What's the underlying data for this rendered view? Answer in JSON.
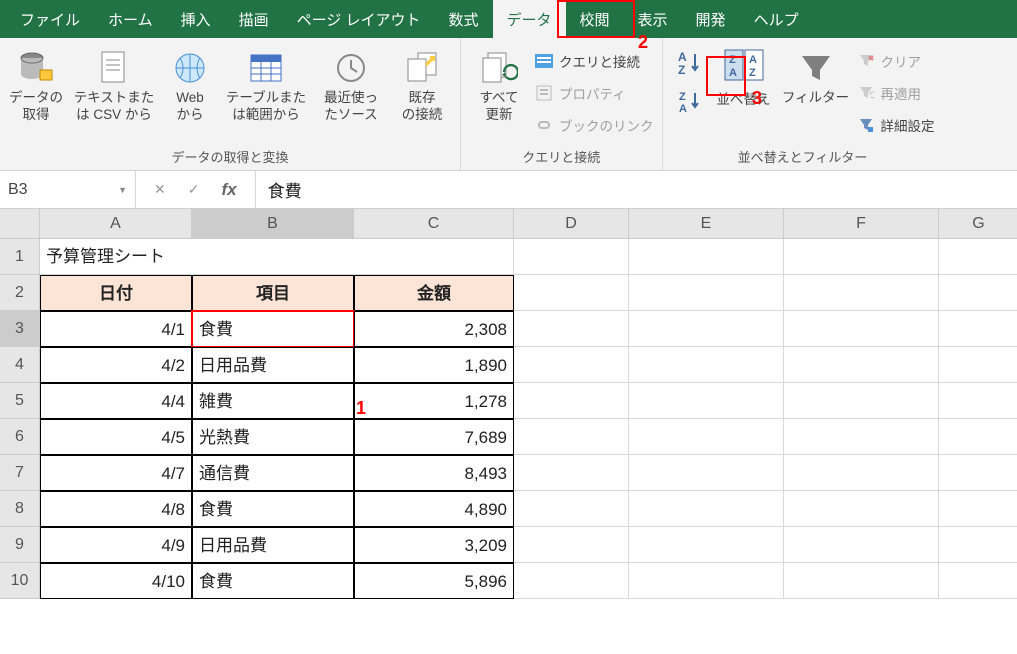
{
  "tabs": [
    "ファイル",
    "ホーム",
    "挿入",
    "描画",
    "ページ レイアウト",
    "数式",
    "データ",
    "校閲",
    "表示",
    "開発",
    "ヘルプ"
  ],
  "active_tab": "データ",
  "ribbon": {
    "group1": {
      "label": "データの取得と変換",
      "btns": {
        "get_data": "データの\n取得",
        "csv": "テキストまた\nは CSV から",
        "web": "Web\nから",
        "table": "テーブルまた\nは範囲から",
        "recent": "最近使っ\nたソース",
        "existing": "既存\nの接続"
      }
    },
    "group2": {
      "label": "クエリと接続",
      "btns": {
        "refresh": "すべて\n更新",
        "queries": "クエリと接続",
        "props": "プロパティ",
        "links": "ブックのリンク"
      }
    },
    "group3": {
      "label": "並べ替えとフィルター",
      "btns": {
        "sort": "並べ替え",
        "filter": "フィルター",
        "clear": "クリア",
        "reapply": "再適用",
        "adv": "詳細設定"
      }
    }
  },
  "name_box": "B3",
  "formula_value": "食費",
  "columns": [
    "A",
    "B",
    "C",
    "D",
    "E",
    "F",
    "G"
  ],
  "rows": [
    "1",
    "2",
    "3",
    "4",
    "5",
    "6",
    "7",
    "8",
    "9",
    "10"
  ],
  "sheet": {
    "title": "予算管理シート",
    "headers": [
      "日付",
      "項目",
      "金額"
    ],
    "data": [
      [
        "4/1",
        "食費",
        "2,308"
      ],
      [
        "4/2",
        "日用品費",
        "1,890"
      ],
      [
        "4/4",
        "雑費",
        "1,278"
      ],
      [
        "4/5",
        "光熱費",
        "7,689"
      ],
      [
        "4/7",
        "通信費",
        "8,493"
      ],
      [
        "4/8",
        "食費",
        "4,890"
      ],
      [
        "4/9",
        "日用品費",
        "3,209"
      ],
      [
        "4/10",
        "食費",
        "5,896"
      ]
    ]
  },
  "annotations": {
    "1": "1",
    "2": "2",
    "3": "3"
  }
}
